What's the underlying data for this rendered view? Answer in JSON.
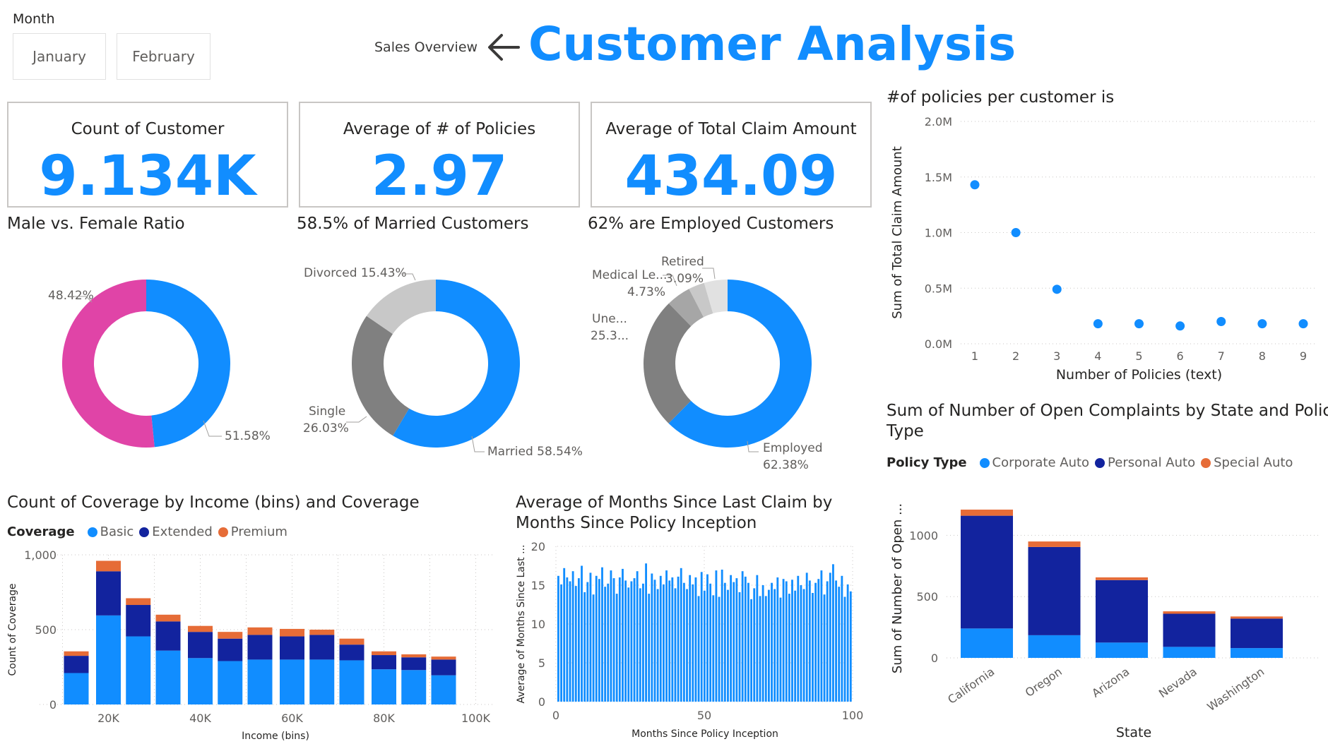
{
  "slicer": {
    "label": "Month",
    "options": [
      "January",
      "February"
    ]
  },
  "nav": {
    "back_label": "Sales Overview"
  },
  "page_title": "Customer Analysis",
  "colors": {
    "blue": "#118dff",
    "navy": "#12239e",
    "orange": "#e66c37",
    "pink": "#e044a7"
  },
  "kpis": [
    {
      "label": "Count of Customer",
      "value": "9.134K"
    },
    {
      "label": "Average of # of Policies",
      "value": "2.97"
    },
    {
      "label": "Average of Total Claim Amount",
      "value": "434.09"
    }
  ],
  "donut_titles": [
    "Male vs. Female Ratio",
    "58.5% of Married Customers",
    "62% are Employed Customers"
  ],
  "scatter_title": "#of policies per customer is",
  "complaints_title_1": "Sum of Number of Open Complaints by State and Policy",
  "complaints_title_2": "Type",
  "coverage_title": "Count of Coverage by Income (bins) and Coverage",
  "months_title_1": "Average of Months Since Last Claim by",
  "months_title_2": "Months Since Policy Inception",
  "legend_coverage": {
    "title": "Coverage",
    "items": [
      "Basic",
      "Extended",
      "Premium"
    ]
  },
  "legend_policy": {
    "title": "Policy Type",
    "items": [
      "Corporate Auto",
      "Personal Auto",
      "Special Auto"
    ]
  },
  "chart_data": [
    {
      "type": "pie",
      "title": "Male vs. Female Ratio",
      "slices": [
        {
          "label": "",
          "value": 48.42,
          "text": "48.42%",
          "color": "#118dff"
        },
        {
          "label": "",
          "value": 51.58,
          "text": "51.58%",
          "color": "#e044a7"
        }
      ]
    },
    {
      "type": "pie",
      "title": "58.5% of Married Customers",
      "slices": [
        {
          "label": "Married",
          "value": 58.54,
          "text": "Married 58.54%",
          "color": "#118dff"
        },
        {
          "label": "Single",
          "value": 26.03,
          "text_lines": [
            "Single",
            "26.03%"
          ],
          "color": "#808080"
        },
        {
          "label": "Divorced",
          "value": 15.43,
          "text": "Divorced 15.43%",
          "color": "#c8c8c8"
        }
      ]
    },
    {
      "type": "pie",
      "title": "62% are Employed Customers",
      "slices": [
        {
          "label": "Employed",
          "value": 62.38,
          "text_lines": [
            "Employed",
            "62.38%"
          ],
          "color": "#118dff"
        },
        {
          "label": "Une...",
          "value": 25.3,
          "text_lines": [
            "Une...",
            "25.3..."
          ],
          "color": "#808080"
        },
        {
          "label": "Medical Le...",
          "value": 4.73,
          "text_lines": [
            "Medical Le...",
            "4.73%"
          ],
          "color": "#a6a6a6"
        },
        {
          "label": "Retired",
          "value": 3.09,
          "text_lines": [
            "Retired",
            "3.09%"
          ],
          "color": "#c8c8c8"
        },
        {
          "label": "",
          "value": 4.5,
          "color": "#e1e1e1"
        }
      ]
    },
    {
      "type": "scatter",
      "title": "#of policies per customer is",
      "xlabel": "Number of Policies (text)",
      "ylabel": "Sum of Total Claim Amount",
      "x": [
        "1",
        "2",
        "3",
        "4",
        "5",
        "6",
        "7",
        "8",
        "9"
      ],
      "y": [
        1.43,
        1.0,
        0.49,
        0.18,
        0.18,
        0.16,
        0.2,
        0.18,
        0.18
      ],
      "yticks": [
        "0.0M",
        "0.5M",
        "1.0M",
        "1.5M",
        "2.0M"
      ],
      "ylim": [
        0,
        2.0
      ]
    },
    {
      "type": "bar",
      "title": "Sum of Number of Open Complaints by State and Policy Type",
      "xlabel": "State",
      "ylabel": "Sum of Number of Open ...",
      "categories": [
        "California",
        "Oregon",
        "Arizona",
        "Nevada",
        "Washington"
      ],
      "series": [
        {
          "name": "Corporate Auto",
          "values": [
            240,
            185,
            125,
            90,
            80
          ]
        },
        {
          "name": "Personal Auto",
          "values": [
            920,
            720,
            510,
            270,
            240
          ]
        },
        {
          "name": "Special Auto",
          "values": [
            50,
            45,
            22,
            20,
            18
          ]
        }
      ],
      "yticks": [
        0,
        500,
        1000
      ],
      "ylim": [
        0,
        1250
      ]
    },
    {
      "type": "bar",
      "title": "Count of Coverage by Income (bins) and Coverage",
      "xlabel": "Income (bins)",
      "ylabel": "Count of Coverage",
      "x": [
        10000,
        20000,
        30000,
        40000,
        50000,
        60000,
        70000,
        80000,
        90000,
        100000
      ],
      "xticks": [
        "20K",
        "40K",
        "60K",
        "80K",
        "100K"
      ],
      "bins": [
        13000,
        20000,
        26500,
        33000,
        40000,
        46500,
        53000,
        60000,
        66500,
        73000,
        80000,
        86500,
        93000
      ],
      "series": [
        {
          "name": "Basic",
          "values": [
            210,
            595,
            455,
            360,
            310,
            290,
            300,
            300,
            300,
            295,
            235,
            230,
            195
          ]
        },
        {
          "name": "Extended",
          "values": [
            115,
            295,
            210,
            195,
            175,
            150,
            165,
            155,
            165,
            105,
            95,
            85,
            105
          ]
        },
        {
          "name": "Premium",
          "values": [
            30,
            70,
            45,
            45,
            40,
            45,
            50,
            50,
            35,
            40,
            25,
            20,
            20
          ]
        }
      ],
      "yticks": [
        "0",
        "500",
        "1,000"
      ],
      "ylim": [
        0,
        1000
      ]
    },
    {
      "type": "bar",
      "title": "Average of Months Since Last Claim by Months Since Policy Inception",
      "xlabel": "Months Since Policy Inception",
      "ylabel": "Average of Months Since Last ...",
      "xticks": [
        "0",
        "50",
        "100"
      ],
      "yticks": [
        "0",
        "5",
        "10",
        "15",
        "20"
      ],
      "ylim": [
        0,
        20
      ],
      "x_start": 0,
      "values": [
        16.2,
        15.1,
        17.2,
        16.0,
        15.5,
        16.8,
        14.9,
        15.9,
        17.5,
        14.1,
        15.4,
        16.6,
        13.8,
        16.2,
        15.8,
        17.3,
        14.8,
        15.2,
        16.9,
        15.9,
        13.9,
        16.0,
        17.1,
        15.6,
        14.7,
        15.5,
        15.9,
        16.8,
        14.6,
        15.2,
        17.8,
        13.9,
        16.5,
        15.7,
        14.5,
        16.2,
        15.1,
        16.9,
        15.6,
        16.0,
        14.6,
        16.1,
        17.2,
        15.3,
        14.5,
        16.3,
        15.1,
        16.0,
        13.6,
        16.7,
        14.3,
        16.4,
        15.2,
        13.7,
        16.9,
        13.5,
        17.0,
        15.3,
        14.4,
        16.3,
        15.4,
        15.9,
        14.1,
        16.8,
        16.1,
        15.3,
        13.2,
        14.6,
        16.3,
        13.6,
        15.0,
        13.6,
        14.4,
        15.3,
        14.5,
        16.0,
        13.4,
        15.8,
        15.5,
        13.9,
        15.7,
        14.3,
        16.2,
        15.0,
        14.5,
        16.6,
        15.6,
        14.0,
        15.3,
        15.8,
        16.9,
        13.8,
        15.5,
        16.6,
        17.7,
        15.6,
        14.8,
        16.2,
        13.5,
        15.1,
        14.2
      ]
    }
  ]
}
